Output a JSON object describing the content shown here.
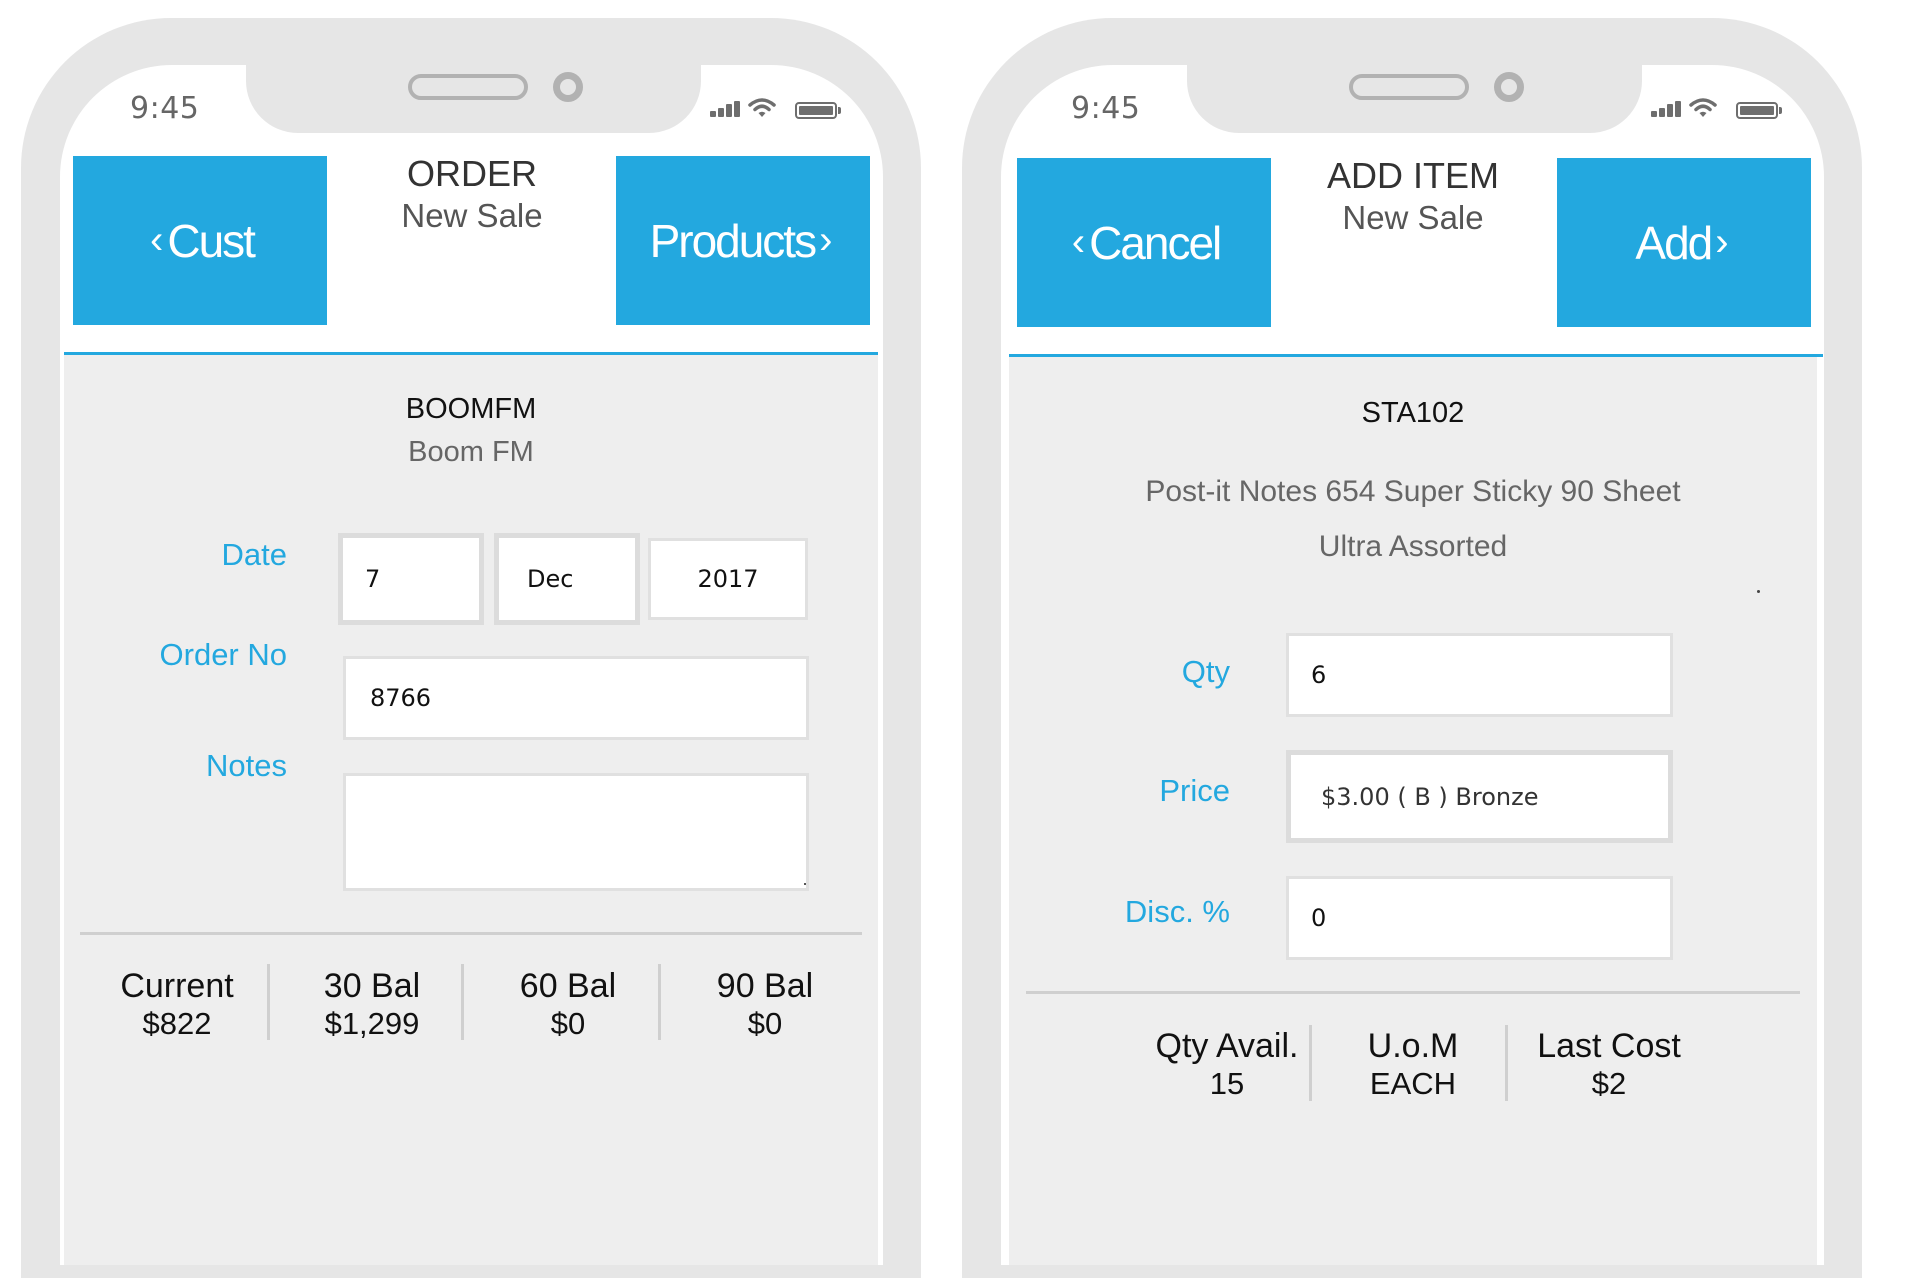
{
  "status_bar": {
    "time": "9:45"
  },
  "order_screen": {
    "back_button": {
      "chevron": "‹",
      "label": "Cust"
    },
    "next_button": {
      "label": "Products",
      "chevron": "›"
    },
    "title": "ORDER",
    "subtitle": "New Sale",
    "customer_code": "BOOMFM",
    "customer_name": "Boom FM",
    "form": {
      "date_label": "Date",
      "date_day": "7",
      "date_month": "Dec",
      "date_year": "2017",
      "order_no_label": "Order No",
      "order_no_value": "8766",
      "notes_label": "Notes",
      "notes_value": ""
    },
    "balances": [
      {
        "label": "Current",
        "value": "$822"
      },
      {
        "label": "30 Bal",
        "value": "$1,299"
      },
      {
        "label": "60 Bal",
        "value": "$0"
      },
      {
        "label": "90 Bal",
        "value": "$0"
      }
    ]
  },
  "add_item_screen": {
    "back_button": {
      "chevron": "‹",
      "label": "Cancel"
    },
    "next_button": {
      "label": "Add",
      "chevron": "›"
    },
    "title": "ADD ITEM",
    "subtitle": "New Sale",
    "product_code": "STA102",
    "product_description_line1": "Post-it Notes 654 Super Sticky 90 Sheet",
    "product_description_line2": "Ultra Assorted",
    "form": {
      "qty_label": "Qty",
      "qty_value": "6",
      "price_label": "Price",
      "price_value": "$3.00 ( B ) Bronze",
      "disc_label": "Disc. %",
      "disc_value": "0"
    },
    "stats": [
      {
        "label": "Qty Avail.",
        "value": "15"
      },
      {
        "label": "U.o.M",
        "value": "EACH"
      },
      {
        "label": "Last Cost",
        "value": "$2"
      }
    ]
  },
  "colors": {
    "accent": "#23a8df",
    "frame": "#e6e6e6",
    "content_bg": "#eeeeee"
  },
  "icons": [
    "signal-icon",
    "wifi-icon",
    "battery-icon",
    "chevron-left-icon",
    "chevron-right-icon"
  ]
}
